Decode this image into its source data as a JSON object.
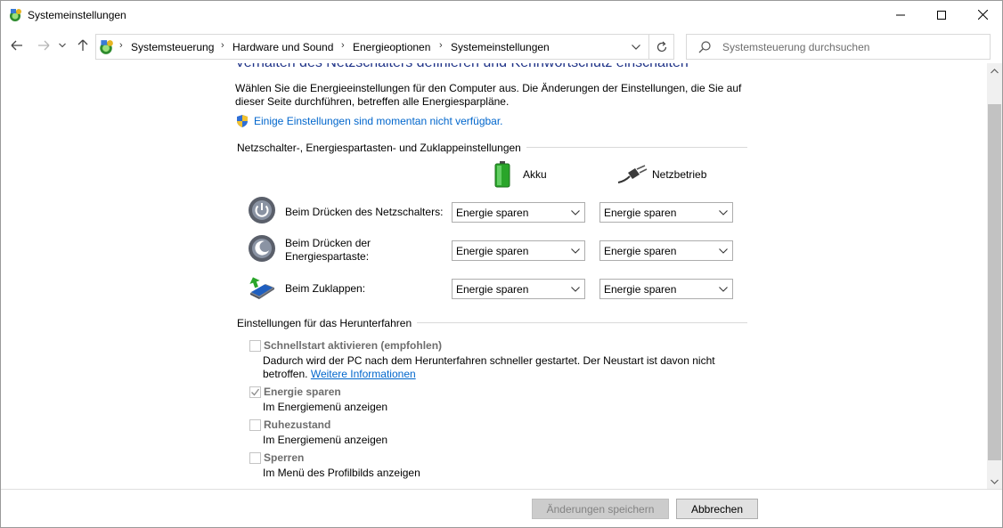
{
  "window": {
    "title": "Systemeinstellungen"
  },
  "address": {
    "crumbs": [
      "Systemsteuerung",
      "Hardware und Sound",
      "Energieoptionen",
      "Systemeinstellungen"
    ],
    "search_placeholder": "Systemsteuerung durchsuchen"
  },
  "page": {
    "heading": "Verhalten des Netzschalters definieren und Kennwortschutz einschalten",
    "description": "Wählen Sie die Energieeinstellungen für den Computer aus. Die Änderungen der Einstellungen, die Sie auf dieser Seite durchführen, betreffen alle Energiesparpläne.",
    "unavailable_link": "Einige Einstellungen sind momentan nicht verfügbar."
  },
  "power_buttons": {
    "group_title": "Netzschalter-, Energiespartasten- und Zuklappeinstellungen",
    "col_battery": "Akku",
    "col_plugged": "Netzbetrieb",
    "rows": [
      {
        "label": "Beim Drücken des Netzschalters:",
        "battery": "Energie sparen",
        "plugged": "Energie sparen"
      },
      {
        "label": "Beim Drücken der Energiespartaste:",
        "battery": "Energie sparen",
        "plugged": "Energie sparen"
      },
      {
        "label": "Beim Zuklappen:",
        "battery": "Energie sparen",
        "plugged": "Energie sparen"
      }
    ]
  },
  "shutdown": {
    "group_title": "Einstellungen für das Herunterfahren",
    "options": [
      {
        "title": "Schnellstart aktivieren (empfohlen)",
        "desc": "Dadurch wird der PC nach dem Herunterfahren schneller gestartet. Der Neustart ist davon nicht betroffen.",
        "link": "Weitere Informationen",
        "checked": false
      },
      {
        "title": "Energie sparen",
        "desc": "Im Energiemenü anzeigen",
        "checked": true
      },
      {
        "title": "Ruhezustand",
        "desc": "Im Energiemenü anzeigen",
        "checked": false
      },
      {
        "title": "Sperren",
        "desc": "Im Menü des Profilbilds anzeigen",
        "checked": false
      }
    ]
  },
  "footer": {
    "save_label": "Änderungen speichern",
    "cancel_label": "Abbrechen"
  },
  "colors": {
    "heading": "#1e3287",
    "link": "#0066cc",
    "disabled_text": "#6d6d6d"
  }
}
